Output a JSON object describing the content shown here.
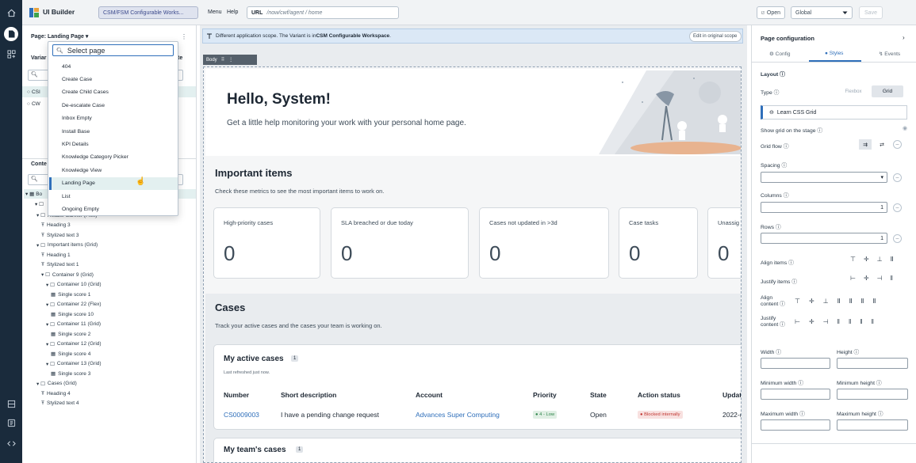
{
  "app": {
    "name": "UI Builder",
    "experience": "CSM/FSM Configurable Works..."
  },
  "topbar": {
    "menu": "Menu",
    "help": "Help",
    "url_label": "URL",
    "url_path": "/now/cwf/agent / home",
    "open_label": "Open",
    "scope_label": "Global",
    "save_label": "Save"
  },
  "left": {
    "page_label": "Page: Landing Page",
    "variant_label": "Variar",
    "variant_suffix": "te",
    "variant_items": [
      "CSI",
      "CW"
    ],
    "content_label": "Conte",
    "tree_root": "Bo",
    "tree": [
      {
        "label": "Header Banner (Flex)",
        "indent": 3,
        "type": "container",
        "expanded": true
      },
      {
        "label": "Heading 3",
        "indent": 4,
        "type": "text"
      },
      {
        "label": "Stylized text 3",
        "indent": 4,
        "type": "text"
      },
      {
        "label": "Important items (Grid)",
        "indent": 3,
        "type": "container",
        "expanded": true
      },
      {
        "label": "Heading 1",
        "indent": 4,
        "type": "text"
      },
      {
        "label": "Stylized text 1",
        "indent": 4,
        "type": "text"
      },
      {
        "label": "Container 9 (Grid)",
        "indent": 4,
        "type": "container",
        "expanded": true
      },
      {
        "label": "Container 10 (Grid)",
        "indent": 5,
        "type": "container",
        "expanded": true
      },
      {
        "label": "Single score 1",
        "indent": 6,
        "type": "score"
      },
      {
        "label": "Container 22 (Flex)",
        "indent": 5,
        "type": "container",
        "expanded": true
      },
      {
        "label": "Single score 10",
        "indent": 6,
        "type": "score"
      },
      {
        "label": "Container 11 (Grid)",
        "indent": 5,
        "type": "container",
        "expanded": true
      },
      {
        "label": "Single score 2",
        "indent": 6,
        "type": "score"
      },
      {
        "label": "Container 12 (Grid)",
        "indent": 5,
        "type": "container",
        "expanded": true
      },
      {
        "label": "Single score 4",
        "indent": 6,
        "type": "score"
      },
      {
        "label": "Container 13 (Grid)",
        "indent": 5,
        "type": "container",
        "expanded": true
      },
      {
        "label": "Single score 3",
        "indent": 6,
        "type": "score"
      },
      {
        "label": "Cases (Grid)",
        "indent": 3,
        "type": "container",
        "expanded": true
      },
      {
        "label": "Heading 4",
        "indent": 4,
        "type": "text"
      },
      {
        "label": "Stylized text 4",
        "indent": 4,
        "type": "text"
      }
    ]
  },
  "page_dropdown": {
    "search_placeholder": "Select page",
    "items": [
      "404",
      "Create Case",
      "Create Child Cases",
      "De-escalate Case",
      "Inbox Empty",
      "Install Base",
      "KPI Details",
      "Knowledge Category Picker",
      "Knowledge View",
      "Landing Page",
      "List",
      "Ongoing Empty"
    ],
    "selected": "Landing Page"
  },
  "banner": {
    "text_prefix": "Different application scope. The Variant is in ",
    "scope_name": "CSM Configurable Workspace",
    "text_suffix": ".",
    "button": "Edit in original scope"
  },
  "stage_tab": "Body",
  "hero": {
    "title": "Hello, System!",
    "subtitle": "Get a little help monitoring your work with your personal home page."
  },
  "important": {
    "title": "Important items",
    "subtitle": "Check these metrics to see the most important items to work on.",
    "cards": [
      {
        "label": "High-priority cases",
        "value": "0"
      },
      {
        "label": "SLA breached or due today",
        "value": "0"
      },
      {
        "label": "Cases not updated in >3d",
        "value": "0"
      },
      {
        "label": "Case tasks",
        "value": "0"
      },
      {
        "label": "Unassig",
        "value": "0"
      }
    ]
  },
  "cases": {
    "title": "Cases",
    "subtitle": "Track your active cases and the cases your team is working on.",
    "active": {
      "title": "My active cases",
      "count": "1",
      "refreshed": "Last refreshed just now.",
      "columns": [
        "Number",
        "Short description",
        "Account",
        "Priority",
        "State",
        "Action status",
        "Updat"
      ],
      "row": {
        "number": "CS0009003",
        "description": "I have a pending change request",
        "account": "Advances Super Computing",
        "priority": "4 - Low",
        "state": "Open",
        "action": "Blocked internally",
        "updated": "2022-("
      }
    },
    "team": {
      "title": "My team's cases",
      "count": "1"
    }
  },
  "right": {
    "title": "Page configuration",
    "tabs": [
      "Config",
      "Styles",
      "Events"
    ],
    "active_tab": "Styles",
    "layout": "Layout",
    "type_label": "Type",
    "type_options": [
      "Flexbox",
      "Grid"
    ],
    "learn": "Learn CSS Grid",
    "show_grid": "Show grid on the stage",
    "grid_flow": "Grid flow",
    "spacing": "Spacing",
    "columns": "Columns",
    "columns_value": "1",
    "rows": "Rows",
    "rows_value": "1",
    "align_items": "Align items",
    "justify_items": "Justify items",
    "align_content": "Align content",
    "justify_content": "Justify content",
    "width": "Width",
    "height": "Height",
    "min_width": "Minimum width",
    "min_height": "Minimum height",
    "max_width": "Maximum width",
    "max_height": "Maximum height"
  },
  "colors": {
    "rail": "#1a2b3c",
    "accent": "#2f6fba",
    "banner": "#dbe8f6",
    "selected": "#e3f0f0",
    "success": "#2e844a",
    "critical": "#c23934"
  }
}
